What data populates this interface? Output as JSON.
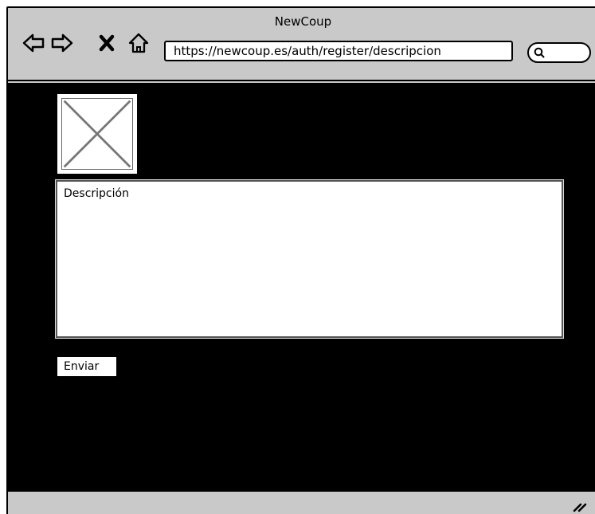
{
  "window": {
    "title": "NewCoup"
  },
  "toolbar": {
    "back_icon": "arrow-left-outline-icon",
    "forward_icon": "arrow-right-outline-icon",
    "stop_icon": "x-icon",
    "home_icon": "house-outline-icon",
    "search_icon": "magnifier-icon"
  },
  "address_bar": {
    "url": "https://newcoup.es/auth/register/descripcion"
  },
  "form": {
    "image_placeholder": "image-placeholder-icon",
    "description_label": "Descripción",
    "description_value": "",
    "submit_label": "Enviar"
  },
  "colors": {
    "chrome": "#c9c9c9",
    "page_background": "#000000",
    "field_background": "#ffffff"
  }
}
